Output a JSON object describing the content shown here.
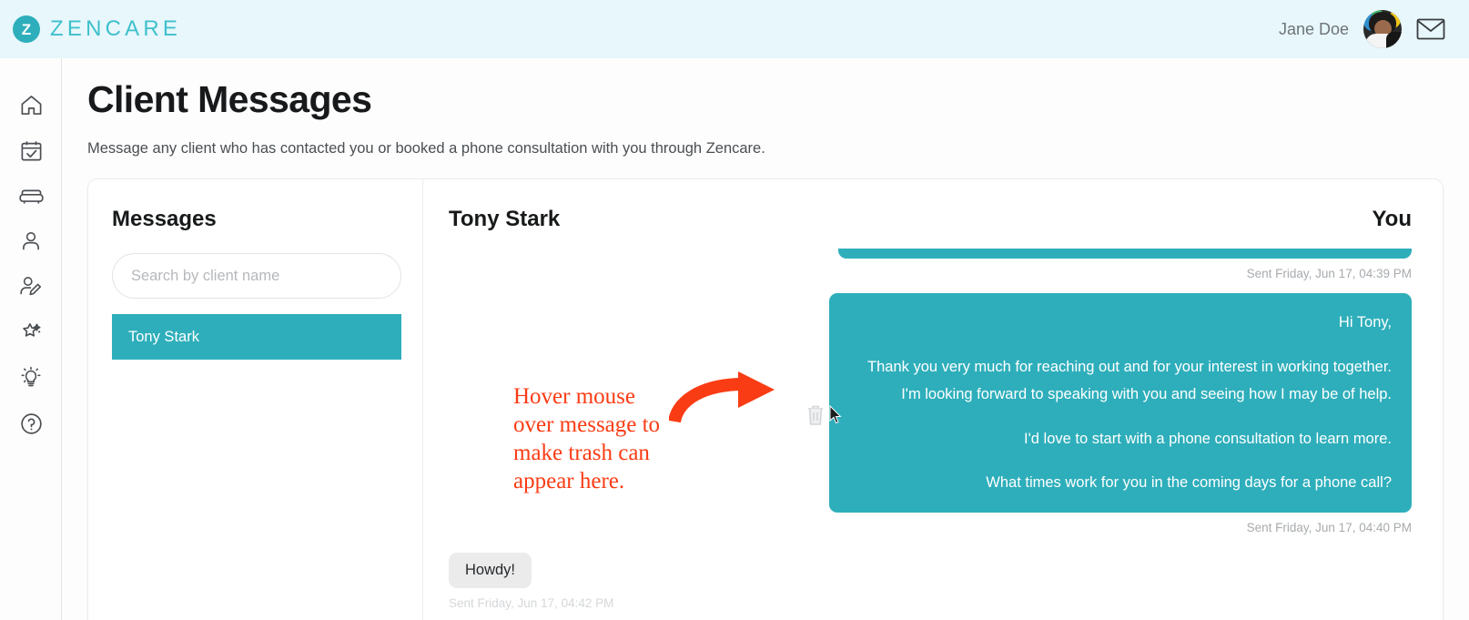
{
  "brand": {
    "mark": "Z",
    "name": "ZENCARE"
  },
  "topbar": {
    "username": "Jane Doe",
    "avatar_name": "Jane Doe avatar",
    "mail_icon": "envelope-icon",
    "bg_color": "#e7f7fb"
  },
  "sidebar": {
    "items": [
      {
        "icon": "home-icon",
        "label": "Home"
      },
      {
        "icon": "calendar-check-icon",
        "label": "Calendar"
      },
      {
        "icon": "couch-icon",
        "label": "Sessions"
      },
      {
        "icon": "person-icon",
        "label": "Profile"
      },
      {
        "icon": "person-edit-icon",
        "label": "Edit Profile"
      },
      {
        "icon": "sparkle-star-icon",
        "label": "Highlights"
      },
      {
        "icon": "lightbulb-icon",
        "label": "Tips"
      },
      {
        "icon": "question-circle-icon",
        "label": "Help"
      }
    ]
  },
  "page": {
    "title": "Client Messages",
    "subtitle": "Message any client who has contacted you or booked a phone consultation with you through Zencare."
  },
  "messages_pane": {
    "title": "Messages",
    "search_placeholder": "Search by client name",
    "search_value": "",
    "clients": [
      {
        "name": "Tony Stark",
        "selected": true
      }
    ]
  },
  "conversation": {
    "client_name": "Tony Stark",
    "you_label": "You",
    "clipped_stamp": "Sent Friday, Jun 17, 04:39 PM",
    "outgoing": {
      "line1": "Hi Tony,",
      "line2": "Thank you very much for reaching out and for your interest in working together. I'm looking forward to speaking with you and seeing how I may be of help.",
      "line3": "I'd love to start with a phone consultation to learn more.",
      "line4": "What times work for you in the coming days for a phone call?",
      "stamp": "Sent Friday, Jun 17, 04:40 PM"
    },
    "incoming": {
      "text": "Howdy!",
      "stamp": "Sent Friday, Jun 17, 04:42 PM"
    },
    "trash_icon": "trash-can-icon",
    "cursor": "mouse-pointer-icon"
  },
  "annotation": {
    "text": "Hover mouse over message to make trash can appear here.",
    "color": "#fa3c14",
    "arrow": "curved-arrow-icon"
  },
  "colors": {
    "accent_teal": "#2eaebb",
    "header_bg": "#e7f7fb",
    "annotation_red": "#fa3c14"
  }
}
